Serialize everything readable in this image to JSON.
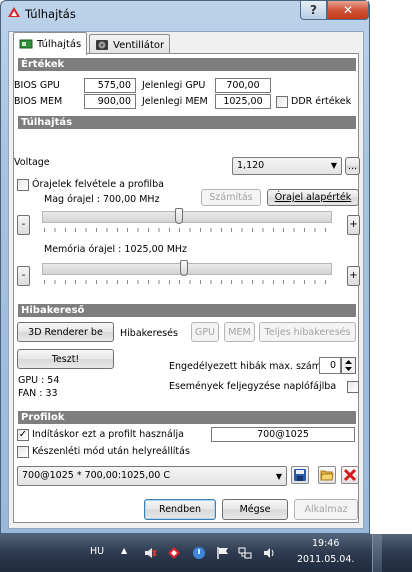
{
  "window": {
    "title": "Túlhajtás",
    "help_label": "?",
    "close_label": "✕"
  },
  "tabs": [
    {
      "label": "Túlhajtás",
      "active": true
    },
    {
      "label": "Ventillátor",
      "active": false
    }
  ],
  "ertekek": {
    "heading": "Értékek",
    "bios_gpu_label": "BIOS GPU",
    "bios_gpu_value": "575,00",
    "bios_mem_label": "BIOS MEM",
    "bios_mem_value": "900,00",
    "cur_gpu_label": "Jelenlegi GPU",
    "cur_gpu_value": "700,00",
    "cur_mem_label": "Jelenlegi MEM",
    "cur_mem_value": "1025,00",
    "ddr_label": "DDR értékek",
    "ddr_checked": false
  },
  "tulhajtas": {
    "heading": "Túlhajtás",
    "voltage_label": "Voltage",
    "voltage_value": "1,120",
    "more_label": "...",
    "record_label": "Órajelek felvétele a profilba",
    "record_checked": false,
    "core_label": "Mag órajel : 700,00 MHz",
    "calc_label": "Számítás",
    "default_label": "Órajel alapérték",
    "minus_label": "-",
    "plus_label": "+",
    "core_slider_fraction": 0.47,
    "mem_label": "Memória órajel : 1025,00 MHz",
    "mem_slider_fraction": 0.49
  },
  "hibakereses": {
    "heading": "Hibakereső",
    "renderer_label": "3D Renderer be",
    "hibakereses_label": "Hibakeresés",
    "gpu_label": "GPU",
    "mem_label": "MEM",
    "full_label": "Teljes hibakeresés",
    "test_label": "Teszt!",
    "max_errors_label": "Engedélyezett hibák max. száma",
    "max_errors_value": "0",
    "log_label": "Események feljegyzése naplófájlba",
    "log_checked": false,
    "gpu_stat": "GPU : 54",
    "fan_stat": "FAN : 33"
  },
  "profilok": {
    "heading": "Profilok",
    "startup_label": "Indításkor ezt a profilt használja",
    "startup_checked": true,
    "startup_profile": "700@1025",
    "restore_label": "Készenléti mód után helyreállítás",
    "restore_checked": false,
    "profile_select": "700@1025 * 700,00:1025,00 C"
  },
  "footer": {
    "ok_label": "Rendben",
    "cancel_label": "Mégse",
    "apply_label": "Alkalmaz"
  },
  "taskbar": {
    "lang": "HU",
    "time": "19:46",
    "date": "2011.05.04."
  },
  "colors": {
    "section_bar": "#7e7e7e",
    "close_red": "#c43b1c",
    "taskbar": "#2d3a4f"
  }
}
